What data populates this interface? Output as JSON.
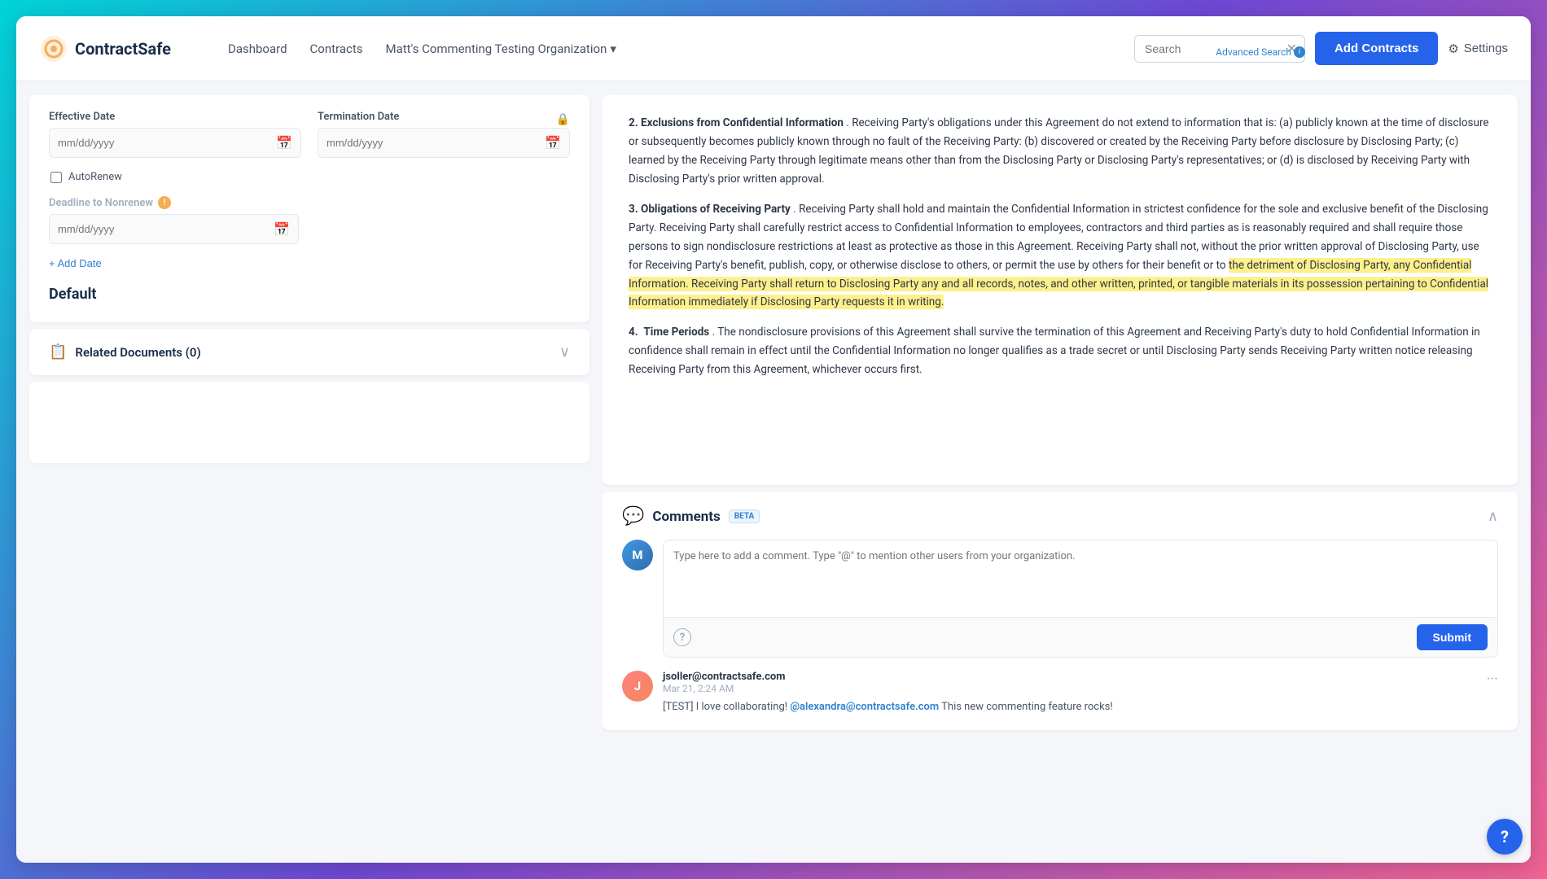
{
  "header": {
    "logo_text": "ContractSafe",
    "nav": {
      "dashboard": "Dashboard",
      "contracts": "Contracts",
      "org": "Matt's Commenting Testing Organization",
      "org_arrow": "▾"
    },
    "search": {
      "placeholder": "Search",
      "value": "",
      "clear": "✕",
      "advanced_label": "Advanced Search",
      "info": "i"
    },
    "add_contracts_label": "Add Contracts",
    "settings_label": "Settings"
  },
  "left_panel": {
    "dates_card": {
      "effective_date_label": "Effective Date",
      "effective_date_placeholder": "mm/dd/yyyy",
      "termination_date_label": "Termination Date",
      "termination_date_placeholder": "mm/dd/yyyy",
      "autorenew_label": "AutoRenew",
      "deadline_label": "Deadline to Nonrenew",
      "deadline_placeholder": "mm/dd/yyyy",
      "add_date_label": "+ Add Date",
      "default_label": "Default"
    },
    "related_docs": {
      "title": "Related Documents (0)"
    }
  },
  "document": {
    "paragraphs": [
      {
        "number": "2.",
        "title": "Exclusions from Confidential Information",
        "text": ". Receiving Party's obligations under this Agreement do not extend to information that is: (a) publicly known at the time of disclosure or subsequently becomes publicly known through no fault of the Receiving Party: (b) discovered or created by the Receiving Party before disclosure by Disclosing Party; (c) learned by the Receiving Party through legitimate means other than from the Disclosing Party or Disclosing Party's representatives; or (d) is disclosed by Receiving Party with Disclosing Party's prior written approval."
      },
      {
        "number": "3.",
        "title": "Obligations of Receiving Party",
        "text_before": ". Receiving Party shall hold and maintain the Confidential Information in strictest confidence for the sole and exclusive benefit of the Disclosing Party. Receiving Party shall carefully restrict access to Confidential Information to employees, contractors and third parties as is reasonably required and shall require those persons to sign nondisclosure restrictions at least as protective as those in this Agreement. Receiving Party shall not, without the prior written approval of Disclosing Party, use for Receiving Party's benefit, publish, copy, or otherwise disclose to others, or permit the use by others for their benefit or to ",
        "highlight": "the detriment of Disclosing Party, any Confidential Information. Receiving Party shall return to Disclosing Party any and all records, notes, and other written, printed, or tangible materials in its possession pertaining to Confidential Information immediately if Disclosing Party requests it in writing.",
        "text_after": ""
      },
      {
        "number": "4.",
        "title": "Time Periods",
        "text": ". The nondisclosure provisions of this Agreement shall survive the termination of this Agreement and Receiving Party's duty to hold Confidential Information in confidence shall remain in effect until the Confidential Information no longer qualifies as a trade secret or until Disclosing Party sends Receiving Party written notice releasing Receiving Party from this Agreement, whichever occurs first."
      }
    ]
  },
  "comments": {
    "title": "Comments",
    "beta_label": "BETA",
    "input_placeholder": "Type here to add a comment. Type \"@\" to mention other users from your organization.",
    "submit_label": "Submit",
    "help_icon": "?",
    "entries": [
      {
        "author": "jsoller@contractsafe.com",
        "avatar_letter": "J",
        "time": "Mar 21, 2:24 AM",
        "text_before": "[TEST] I love collaborating! ",
        "mention": "@alexandra@contractsafe.com",
        "text_after": " This new commenting feature rocks!"
      }
    ]
  },
  "icons": {
    "logo": "◎",
    "calendar": "📅",
    "lock": "🔒",
    "docs": "📋",
    "comment": "💬",
    "gear": "⚙",
    "chevron_down": "∨",
    "chevron_up": "∧",
    "plus": "+",
    "ellipsis": "···",
    "help_circle": "?"
  },
  "user_avatar": {
    "letter": "M",
    "color": "#4299e1"
  }
}
